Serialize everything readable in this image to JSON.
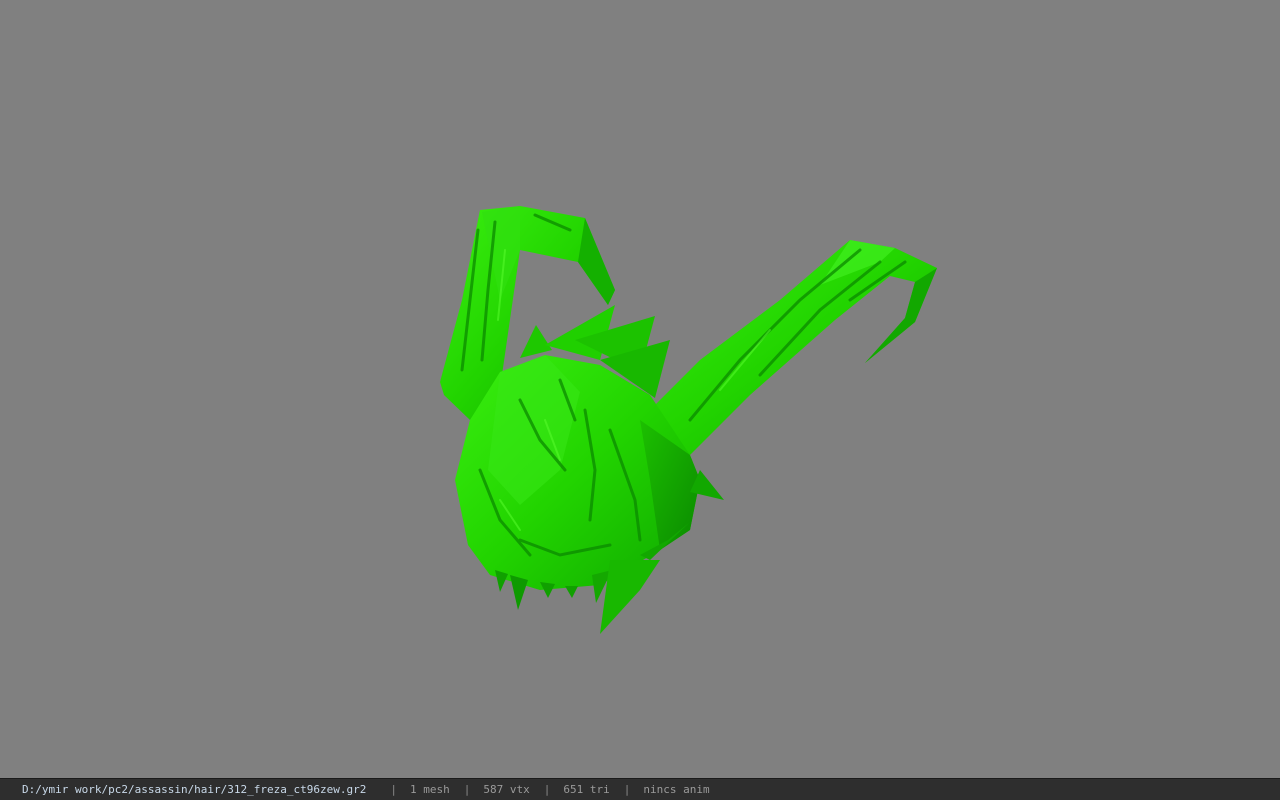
{
  "viewer": {
    "background_color": "#808080",
    "model": {
      "icon": "3d-hair-mesh",
      "color": "#22dd00"
    }
  },
  "statusbar": {
    "file_path": "D:/ymir work/pc2/assassin/hair/312_freza_ct96zew.gr2",
    "separator": "|",
    "mesh_count": "1 mesh",
    "vertex_count": "587 vtx",
    "triangle_count": "651 tri",
    "anim_status": "nincs anim"
  }
}
